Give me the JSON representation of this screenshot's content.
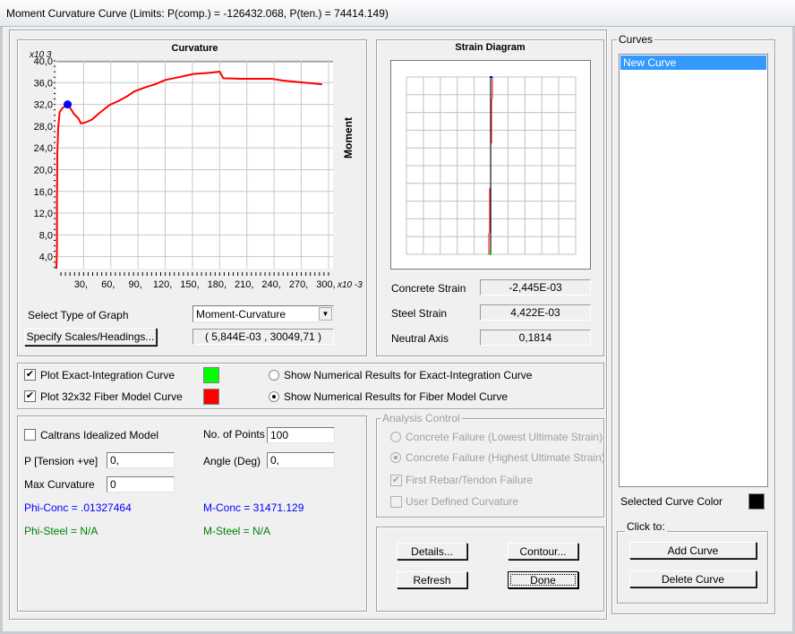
{
  "window": {
    "title": "Moment Curvature Curve (Limits:  P(comp.) = -126432.068, P(ten.) = 74414.149)"
  },
  "chart_panel": {
    "select_type_label": "Select Type of Graph",
    "graph_type": "Moment-Curvature",
    "specify_button": "Specify Scales/Headings...",
    "cursor_readout": "( 5,844E-03 , 30049,71 )"
  },
  "chart_data": {
    "type": "line",
    "title": "Curvature",
    "ylabel": "Moment",
    "y_multiplier": "x10 3",
    "x_multiplier": "x10 -3",
    "xlim": [
      0,
      305
    ],
    "ylim": [
      1.8,
      40
    ],
    "grid": true,
    "x_ticks": [
      "30,",
      "60,",
      "90,",
      "120,",
      "150,",
      "180,",
      "210,",
      "240,",
      "270,",
      "300,"
    ],
    "x_tick_values": [
      30,
      60,
      90,
      120,
      150,
      180,
      210,
      240,
      270,
      300
    ],
    "y_ticks": [
      "4,0",
      "8,0",
      "12,0",
      "16,0",
      "20,0",
      "24,0",
      "28,0",
      "32,0",
      "36,0",
      "40,0"
    ],
    "y_tick_values": [
      4,
      8,
      12,
      16,
      20,
      24,
      28,
      32,
      36,
      40
    ],
    "series": [
      {
        "color": "#ff0000",
        "x": [
          0,
          0.6,
          0.6,
          1,
          2,
          3.6,
          6.5,
          12.4,
          16.6,
          19.5,
          24.4,
          27,
          32.5,
          39,
          48.8,
          58.6,
          68.3,
          78,
          86,
          99,
          109,
          120,
          135,
          151,
          168,
          180,
          184,
          203,
          237.5,
          249,
          268,
          293
        ],
        "y": [
          1.8,
          5,
          13.6,
          22.8,
          27.7,
          30.6,
          31.3,
          32.0,
          31,
          30.2,
          29.4,
          28.5,
          28.7,
          29.2,
          30.6,
          31.9,
          32.6,
          33.5,
          34.4,
          35.2,
          35.7,
          36.5,
          37.0,
          37.6,
          37.8,
          38.0,
          36.8,
          36.7,
          36.7,
          36.4,
          36.1,
          35.7
        ]
      }
    ],
    "marker": {
      "x": 12.4,
      "y": 32.0,
      "color": "#0000ff"
    }
  },
  "strain_panel": {
    "title": "Strain Diagram",
    "concrete_strain_label": "Concrete Strain",
    "concrete_strain": "-2,445E-03",
    "steel_strain_label": "Steel Strain",
    "steel_strain": "4,422E-03",
    "neutral_axis_label": "Neutral Axis",
    "neutral_axis": "0,1814"
  },
  "plot_options": {
    "exact_label": "Plot Exact-Integration Curve",
    "exact_checked": true,
    "exact_color": "#00ff00",
    "fiber_label": "Plot 32x32 Fiber Model Curve",
    "fiber_checked": true,
    "fiber_color": "#ff0000",
    "show_exact_label": "Show Numerical Results for Exact-Integration Curve",
    "show_fiber_label": "Show Numerical Results for Fiber Model Curve",
    "selected_result": "fiber"
  },
  "inputs": {
    "caltrans_label": "Caltrans Idealized Model",
    "caltrans_checked": false,
    "points_label": "No. of Points",
    "points": "100",
    "p_label": "P [Tension +ve]",
    "p": "0,",
    "angle_label": "Angle (Deg)",
    "angle": "0,",
    "maxcurv_label": "Max Curvature",
    "maxcurv": "0",
    "phi_conc": "Phi-Conc = .01327464",
    "m_conc": "M-Conc = 31471.129",
    "phi_steel": "Phi-Steel = N/A",
    "m_steel": "M-Steel = N/A"
  },
  "analysis_control": {
    "title": "Analysis Control",
    "lowest": "Concrete Failure (Lowest Ultimate Strain)",
    "highest": "Concrete Failure (Highest Ultimate Strain)",
    "rebar": "First Rebar/Tendon Failure",
    "user": "User Defined Curvature"
  },
  "buttons": {
    "details": "Details...",
    "contour": "Contour...",
    "refresh": "Refresh",
    "done": "Done"
  },
  "curves": {
    "title": "Curves",
    "items": [
      "New Curve"
    ],
    "selected_color_label": "Selected Curve Color",
    "selected_color": "#000000",
    "click_to": "Click to:",
    "add": "Add Curve",
    "delete": "Delete Curve"
  }
}
